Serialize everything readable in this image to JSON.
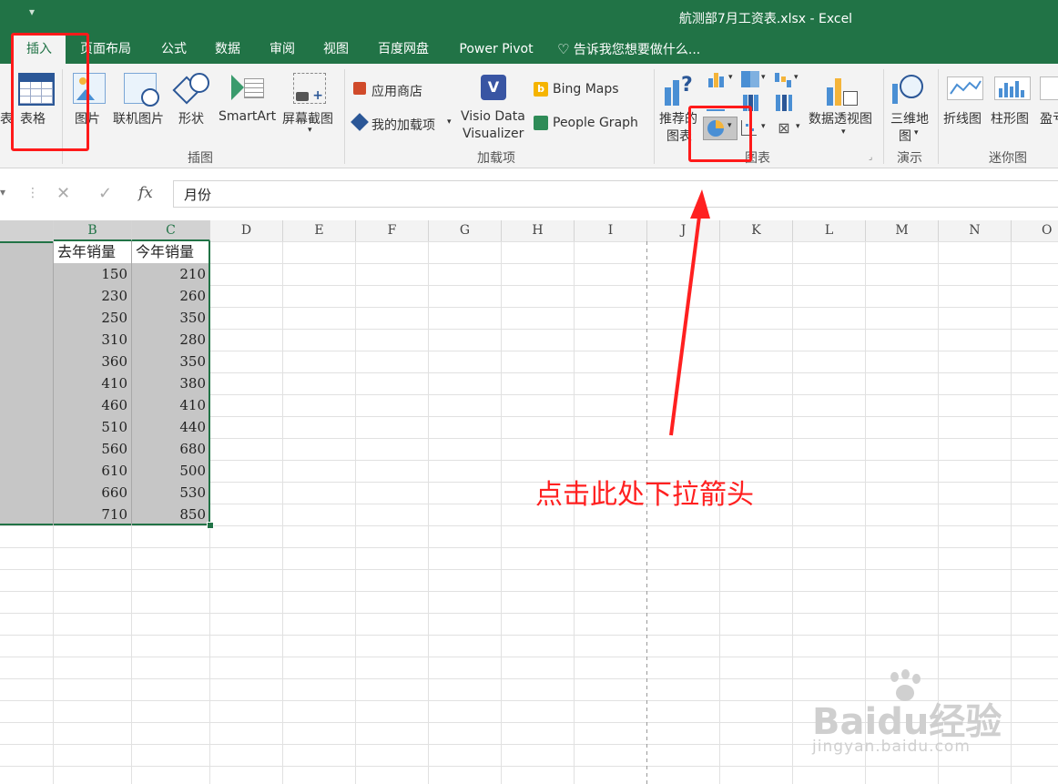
{
  "window": {
    "title": "航测部7月工资表.xlsx - Excel",
    "qat_glyph": "▾"
  },
  "tabs": [
    {
      "label": "插入",
      "active": true
    },
    {
      "label": "页面布局"
    },
    {
      "label": "公式"
    },
    {
      "label": "数据"
    },
    {
      "label": "审阅"
    },
    {
      "label": "视图"
    },
    {
      "label": "百度网盘"
    },
    {
      "label": "Power Pivot"
    }
  ],
  "tell_me": "告诉我您想要做什么...",
  "ribbon": {
    "tables": {
      "table_label": "表格",
      "partial_left": "表"
    },
    "illustrations": {
      "picture_label": "图片",
      "online_picture_label": "联机图片",
      "shapes_label": "形状",
      "smartart_label": "SmartArt",
      "screenshot_label": "屏幕截图",
      "group_label": "插图"
    },
    "addins": {
      "store_label": "应用商店",
      "my_addins_label": "我的加载项",
      "visio_label_1": "Visio Data",
      "visio_label_2": "Visualizer",
      "bing_maps_label": "Bing Maps",
      "people_graph_label": "People Graph",
      "group_label": "加载项"
    },
    "charts": {
      "recommended_label_1": "推荐的",
      "recommended_label_2": "图表",
      "pivot_chart_label": "数据透视图",
      "group_label": "图表"
    },
    "tours": {
      "map3d_label_1": "三维地",
      "map3d_label_2": "图",
      "group_label": "演示"
    },
    "sparklines": {
      "line_label": "折线图",
      "column_label": "柱形图",
      "winloss_partial": "盈亏",
      "group_label": "迷你图"
    }
  },
  "formula_bar": {
    "value": "月份",
    "cancel": "✕",
    "enter": "✓",
    "fx": "fx"
  },
  "columns": [
    "B",
    "C",
    "D",
    "E",
    "F",
    "G",
    "H",
    "I",
    "J",
    "K",
    "L",
    "M",
    "N",
    "O"
  ],
  "table": {
    "headers": [
      "去年销量",
      "今年销量"
    ],
    "rows": [
      [
        "150",
        "210"
      ],
      [
        "230",
        "260"
      ],
      [
        "250",
        "350"
      ],
      [
        "310",
        "280"
      ],
      [
        "360",
        "350"
      ],
      [
        "410",
        "380"
      ],
      [
        "460",
        "410"
      ],
      [
        "510",
        "440"
      ],
      [
        "560",
        "680"
      ],
      [
        "610",
        "500"
      ],
      [
        "660",
        "530"
      ],
      [
        "710",
        "850"
      ]
    ]
  },
  "annotation": {
    "text": "点击此处下拉箭头",
    "color": "#ff2020"
  },
  "watermark": {
    "brand": "Baidu经验",
    "url": "jingyan.baidu.com"
  },
  "colors": {
    "accent": "#217346",
    "annotation": "#ff1a1a"
  }
}
